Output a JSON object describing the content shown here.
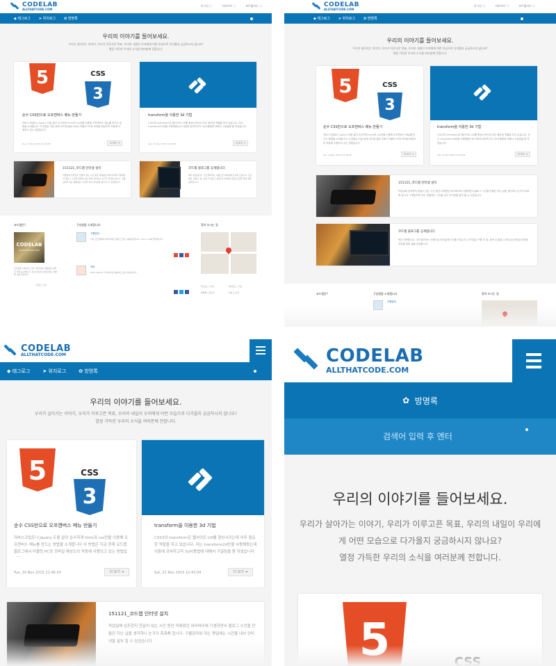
{
  "brand": {
    "name": "CODELAB",
    "sub": "ALLTHATCODE.COM"
  },
  "top_links": [
    "로그인 ⓘ",
    "아카이브 ⓘ",
    "포트폴리오 ⓘ"
  ],
  "nav": {
    "tag": "태그로그",
    "location": "위치로그",
    "guestbook": "방명록",
    "search_placeholder": "검색어 입력 후 엔터"
  },
  "hero": {
    "title": "우리의 이야기를 들어보세요.",
    "desc1": "우리가 살아가는 이야기, 우리가 이루고픈 목표, 우리의 내일이 우리에게 어떤 모습으로 다가올지 궁금하시지 않나요?",
    "desc2": "열정 가득한 우리의 소식을 여러분께 전합니다."
  },
  "posts": [
    {
      "title": "순수 CSS만으로 오프캔버스 메뉴 만들기",
      "excerpt": "자바스크립트나 Jquery 도움 없이 순수하게 html과 css만을 이용해 오프캔버스 메뉴를 만드는 방법을 소개합니다 이 방법은 지금 현재 코드랩 블로그에서 타블릿 PC와 모바일 해상도의 작동에 사용되고 있는 방법입니다",
      "date": "Tue, 24 Nov 2015 21:46:34",
      "more": "더 보기"
    },
    {
      "title": "transform을 이용한 3d 기법",
      "excerpt": "CSS3의 transform은 웹사이트 UX를 향상시키는데 아주 중요한 역할을 하고 있습니다. 저는 transform2d만을 사용해왔는데 이참에 공부하고자 3d사용법에 대해서 구글링을 좀 하였습니다",
      "date": "Sat, 21 Nov 2015 12:42:09",
      "more": "더 보기"
    },
    {
      "title": "151121_코드랩 인터넷 설치",
      "excerpt": "작업실에 입주한지 한달이 넘는 시간 동안 미뤄왔던 와이파이에 기생하면서 블로그 스킨을 만들던 지난 날을 생각하니 눈가가 촉촉해 집니다. 구름감자와 저는 평일에는 시간을 내서 인터넷을 설치 할 수 있었습니다",
      "date": "",
      "more": ""
    },
    {
      "title": "코드랩 블로그를 공개합니다.",
      "excerpt": "매우 빈번합니다. 코드랩이라는 이름으로 여러분께 인사를 드립니다. 코드랩은 구름 추 워, 호락 쉬 블로그 운영 및 여러분과 함께 코딩을 위한 글을 공유합니다.",
      "date": "",
      "more": ""
    }
  ],
  "footer": {
    "about_title": "코드랩은?",
    "about_text": "코드랩은 디자이너 크리, 퍼블리셔 구름감자 이뤄진 작은 공간입니다. 웹 디자인과 프론트엔드 개발을 이야기합니다.",
    "about_link": "- 블로그 소개",
    "members_title": "구성원을 소개합니다",
    "member1_name": "구름감자",
    "member1_text": "저는 코드랩에서 퍼블리셔로 일하고 있는 구름감자입니다. html, css를 좋아합니다.",
    "member2_name": "지바",
    "member2_text": "Hello World! 디자이너로 활동하고 있는 지바입니다.",
    "map_title": "찾아 오시는 길",
    "links": [
      "태그로그 / 태그",
      "위치로그 / 지도",
      "방명록 / 글쓰기",
      "블로그 소개"
    ]
  },
  "colors": {
    "accent": "#0a74b5",
    "html5": "#e44d26",
    "css3": "#1f6fb4",
    "bg": "#f4f4f4"
  }
}
